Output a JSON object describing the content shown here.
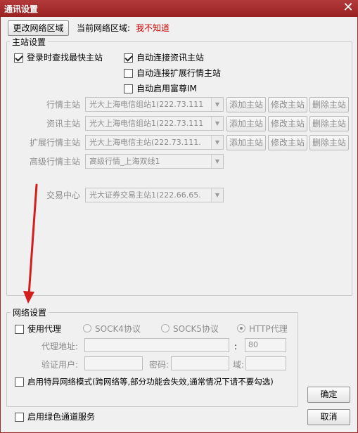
{
  "window": {
    "title": "通讯设置",
    "close_glyph": "✕"
  },
  "region": {
    "change_button": "更改网络区域",
    "current_label": "当前网络区域:",
    "current_value": "我不知道"
  },
  "main_station": {
    "legend": "主站设置",
    "checkbox_fastest": {
      "label": "登录时查找最快主站",
      "checked": true
    },
    "checkbox_auto_info": {
      "label": "自动连接资讯主站",
      "checked": true
    },
    "checkbox_auto_ext": {
      "label": "自动连接扩展行情主站",
      "checked": false
    },
    "checkbox_auto_fuzun": {
      "label": "自动启用富尊IM",
      "checked": false
    },
    "rows": [
      {
        "label": "行情主站",
        "value": "光大上海电信组站1(222.73.111",
        "add": "添加主站",
        "edit": "修改主站",
        "delete": "删除主站"
      },
      {
        "label": "资讯主站",
        "value": "光大上海电信组站1(222.73.111",
        "add": "添加主站",
        "edit": "修改主站",
        "delete": "删除主站"
      },
      {
        "label": "扩展行情主站",
        "value": "光大上海电信主站(222.73.111.",
        "add": "添加主站",
        "edit": "修改主站",
        "delete": "删除主站"
      },
      {
        "label": "高级行情主站",
        "value": "高级行情_上海双线1"
      }
    ],
    "trade_center": {
      "label": "交易中心",
      "value": "光大证券交易主站1(222.66.65."
    }
  },
  "network": {
    "legend": "网络设置",
    "use_proxy": {
      "label": "使用代理",
      "checked": false
    },
    "protocols": [
      {
        "label": "SOCK4协议",
        "selected": false
      },
      {
        "label": "SOCK5协议",
        "selected": false
      },
      {
        "label": "HTTP代理",
        "selected": true
      }
    ],
    "proxy_address_label": "代理地址:",
    "proxy_address_value": "",
    "colon": ":",
    "port_value": "80",
    "auth_user_label": "验证用户:",
    "password_label": "密码:",
    "domain_label": "域:",
    "special_mode": {
      "label": "启用特异网络模式(跨网络等,部分功能会失效,通常情况下请不要勾选)",
      "checked": false
    }
  },
  "green_channel": {
    "label": "启用绿色通道服务",
    "checked": false
  },
  "buttons": {
    "ok": "确定",
    "cancel": "取消"
  },
  "colors": {
    "title_bar": "#a82e2e",
    "warning_text": "#cc0000",
    "annotation_arrow": "#d41e1e"
  }
}
